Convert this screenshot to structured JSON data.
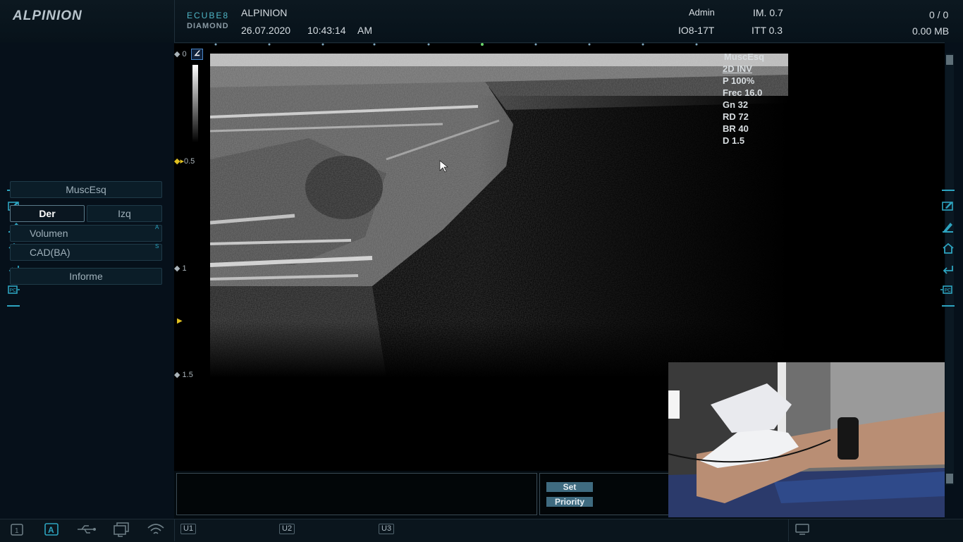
{
  "header": {
    "brand": "ALPINION",
    "model_line1": "ECUBE8",
    "model_line2": "DIAMOND",
    "institution": "ALPINION",
    "date": "26.07.2020",
    "time": "10:43:14",
    "ampm": "AM",
    "user": "Admin",
    "probe": "IO8-17T",
    "mi": "IM. 0.7",
    "itt": "ITT 0.3",
    "count": "0 / 0",
    "size": "0.00 MB"
  },
  "left_panel": {
    "preset": "MuscEsq",
    "side_right": "Der",
    "side_left": "Izq",
    "volume": "Volumen",
    "volume_key": "A",
    "cad": "CAD(BA)",
    "cad_key": "S",
    "report": "Informe"
  },
  "image": {
    "depth_marks": [
      "0",
      "0.5",
      "1",
      "1.5"
    ],
    "params": {
      "preset": "MuscEsq",
      "mode": "2D INV",
      "power": "P 100%",
      "freq": "Frec 16.0",
      "gain": "Gn 32",
      "dynamic_range": "RD 72",
      "brightness": "BR 40",
      "depth": "D 1.5"
    }
  },
  "bottom": {
    "set_label": "Set",
    "priority_label": "Priority",
    "user_keys": [
      "U1",
      "U2",
      "U3"
    ]
  },
  "colors": {
    "accent": "#2da4c0",
    "button": "#3f6b80",
    "background": "#040b10"
  },
  "icons": [
    "monitor-icon",
    "auto-icon",
    "usb-icon",
    "network-icon",
    "wifi-icon",
    "edit-icon",
    "pencil-icon",
    "home-icon",
    "return-icon",
    "pc-icon",
    "screen-icon"
  ]
}
